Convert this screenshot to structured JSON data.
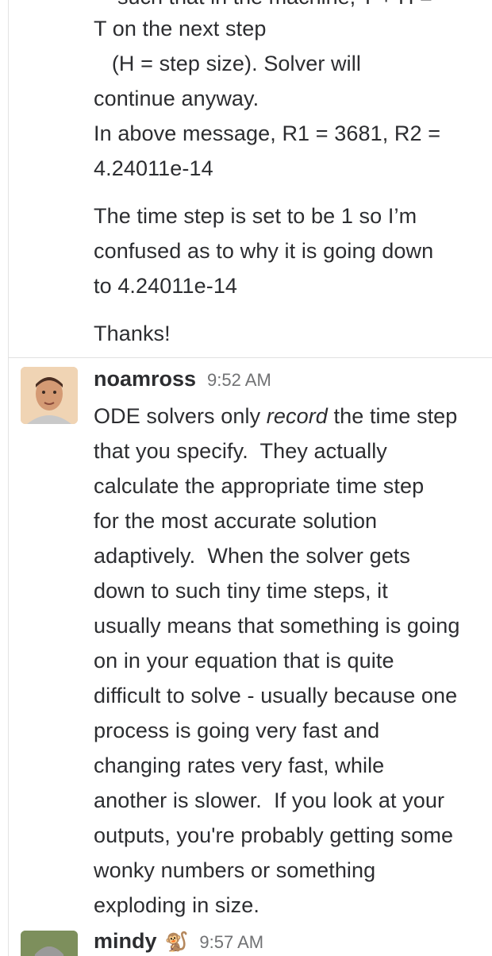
{
  "clipped_line": "such that in the machine, T + H =",
  "prev_message": {
    "lines_block1": "T on the next step\n   (H = step size). Solver will\ncontinue anyway.\nIn above message, R1 = 3681, R2 =\n4.24011e-14",
    "paragraph2": "The time step is set to be 1 so I’m\nconfused as to why it is going down\nto 4.24011e-14",
    "paragraph3": "Thanks!"
  },
  "messages": [
    {
      "author": "noamross",
      "time": "9:52 AM",
      "body_pre": "ODE solvers only ",
      "body_em": "record",
      "body_post": " the time step\nthat you specify.  They actually\ncalculate the appropriate time step\nfor the most accurate solution\nadaptively.  When the solver gets\ndown to such tiny time steps, it\nusually means that something is going\non in your equation that is quite\ndifficult to solve - usually because one\nprocess is going very fast and\nchanging rates very fast, while\nanother is slower.  If you look at your\noutputs, you're probably getting some\nwonky numbers or something\nexploding in size."
    },
    {
      "author": "mindy",
      "status_emoji": "🐒",
      "time": "9:57 AM"
    }
  ]
}
